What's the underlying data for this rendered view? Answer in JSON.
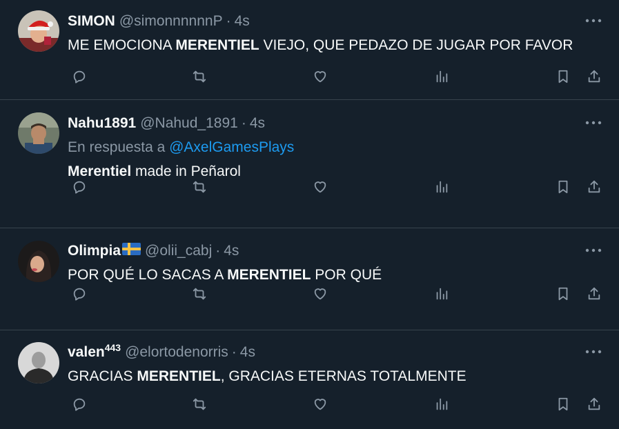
{
  "tweets": [
    {
      "display_name": "SIMON",
      "handle": "@simonnnnnnP",
      "separator": "·",
      "time": "4s",
      "text_parts": [
        "ME EMOCIONA ",
        "MERENTIEL",
        " VIEJO, QUE PEDAZO DE JUGAR POR FAVOR"
      ]
    },
    {
      "display_name": "Nahu1891",
      "handle": "@Nahud_1891",
      "separator": "·",
      "time": "4s",
      "reply_prefix": "En respuesta a ",
      "reply_handle": "@AxelGamesPlays",
      "text_parts": [
        "Merentiel",
        " made in Peñarol"
      ]
    },
    {
      "display_name": "Olimpia",
      "flag": "sweden-flag",
      "handle": "@olii_cabj",
      "separator": "·",
      "time": "4s",
      "text_parts": [
        "POR QUÉ LO SACAS A ",
        "MERENTIEL",
        " POR QUÉ"
      ]
    },
    {
      "display_name": "valen",
      "display_name_sup": "443",
      "handle": "@elortodenorris",
      "separator": "·",
      "time": "4s",
      "text_parts": [
        "GRACIAS ",
        "MERENTIEL",
        ", GRACIAS ETERNAS TOTALMENTE"
      ]
    }
  ],
  "icons": {
    "more": "more-horizontal-icon",
    "reply": "reply-icon",
    "retweet": "retweet-icon",
    "like": "heart-icon",
    "views": "views-chart-icon",
    "bookmark": "bookmark-icon",
    "share": "share-icon"
  },
  "colors": {
    "background": "#15202b",
    "text": "#f7f9f9",
    "muted": "#8b98a5",
    "link": "#1d9bf0",
    "divider": "#38444d"
  }
}
